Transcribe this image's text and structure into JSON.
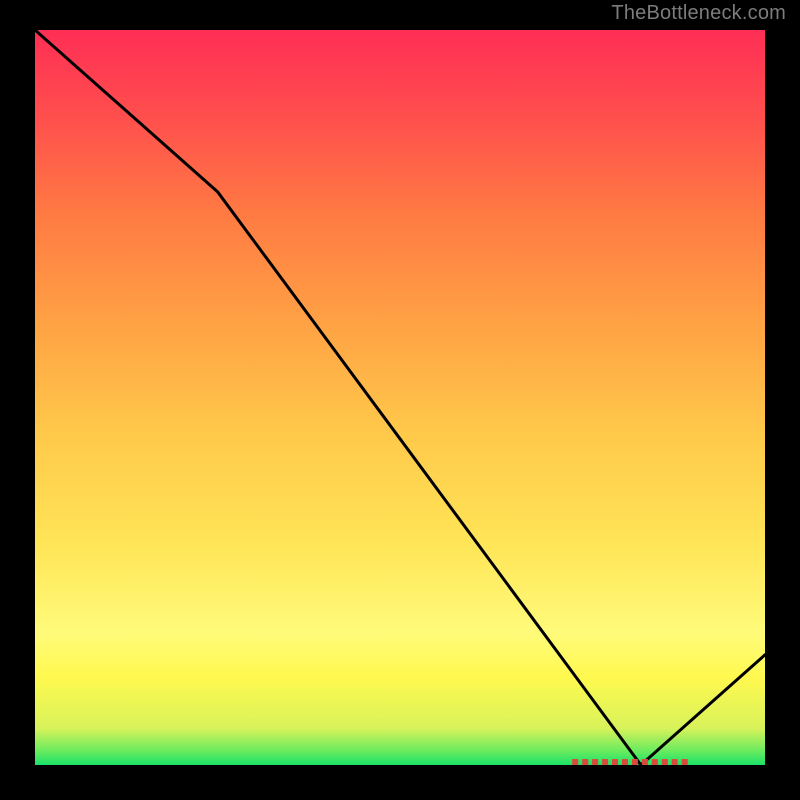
{
  "attribution": "TheBottleneck.com",
  "chart_data": {
    "type": "line",
    "title": "",
    "xlabel": "",
    "ylabel": "",
    "xlim": [
      0,
      100
    ],
    "ylim": [
      0,
      100
    ],
    "series": [
      {
        "name": "bottleneck-curve",
        "x": [
          0,
          25,
          83,
          100
        ],
        "values": [
          100,
          78,
          0,
          15
        ]
      }
    ],
    "annotations": [
      {
        "name": "optimal-range-marker",
        "x_start": 74,
        "x_end": 89,
        "y": 0
      }
    ],
    "gradient_stops": [
      {
        "pos": 0,
        "color": "#1be26a"
      },
      {
        "pos": 5,
        "color": "#d8f25a"
      },
      {
        "pos": 15,
        "color": "#fffb7a"
      },
      {
        "pos": 30,
        "color": "#ffe557"
      },
      {
        "pos": 50,
        "color": "#ffb247"
      },
      {
        "pos": 75,
        "color": "#ff7a43"
      },
      {
        "pos": 100,
        "color": "#ff2e55"
      }
    ]
  },
  "colors": {
    "line": "#000000",
    "marker": "#d94a3a",
    "frame": "#000000",
    "attribution": "#7c7c7c"
  }
}
